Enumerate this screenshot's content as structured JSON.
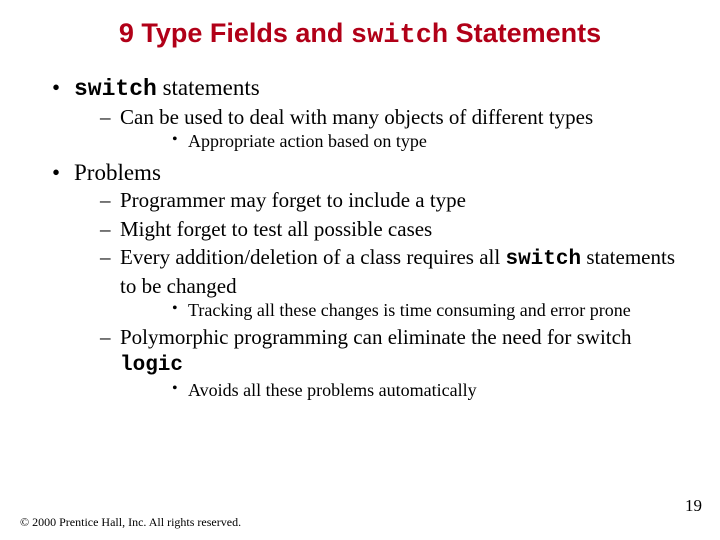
{
  "title": {
    "prefix": "9   Type Fields and ",
    "mono": "switch",
    "suffix": " Statements"
  },
  "b1": {
    "mono": "switch",
    "tail": " statements",
    "s1": "Can be used to deal with many objects of different types",
    "s1a": "Appropriate action based on type"
  },
  "b2": {
    "label": "Problems",
    "s1": "Programmer may forget to include a type",
    "s2": "Might forget to test all possible cases",
    "s3_pre": "Every addition/deletion of a class requires all ",
    "s3_mono": "switch",
    "s3_post": " statements to be changed",
    "s3a": "Tracking all these changes is time consuming and error prone",
    "s4_pre": "Polymorphic programming can eliminate the need for switch ",
    "s4_mono": "logic",
    "s4a": "Avoids all these problems automatically"
  },
  "footer": "© 2000 Prentice Hall, Inc. All rights reserved.",
  "page": "19"
}
